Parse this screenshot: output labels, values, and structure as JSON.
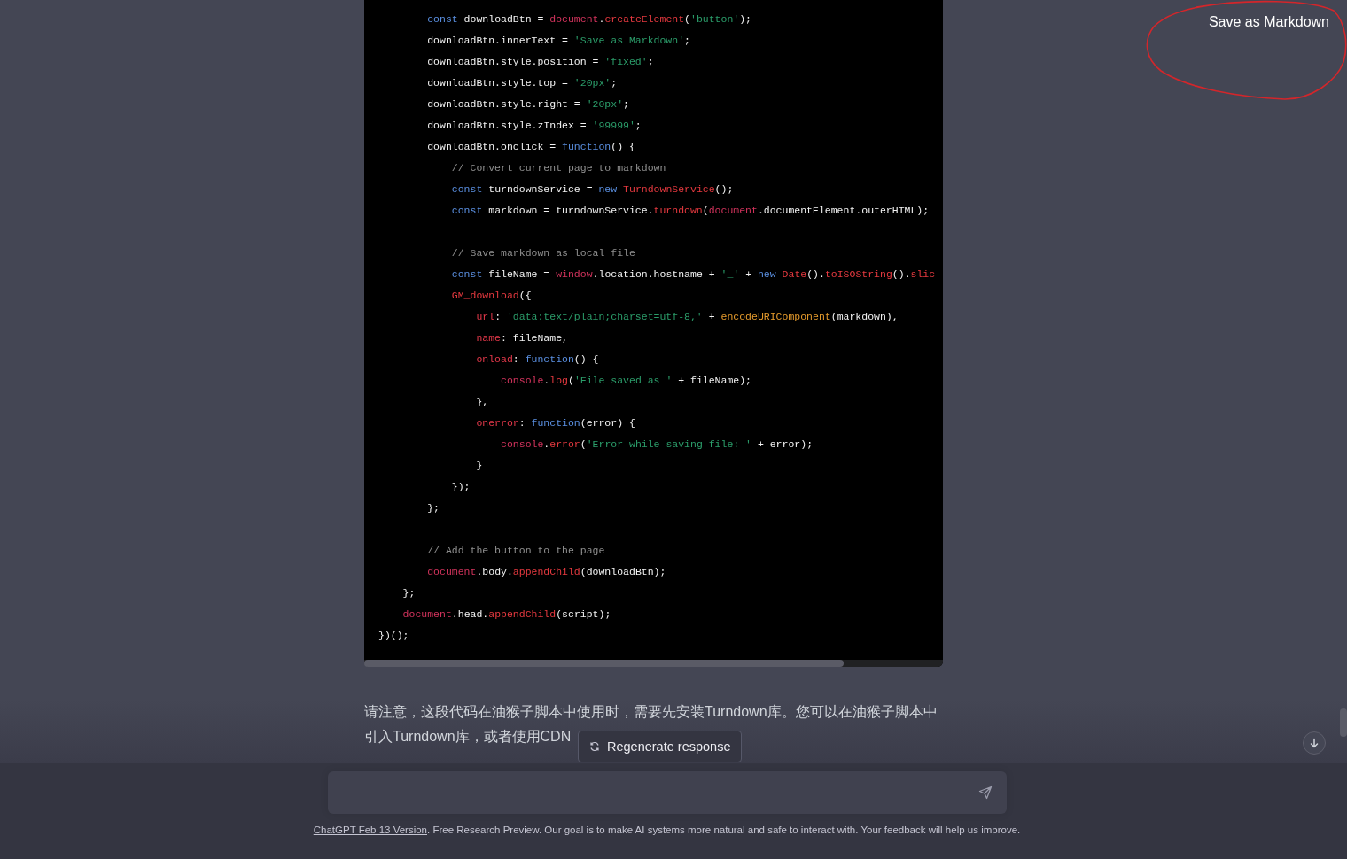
{
  "code_block": {
    "lines": [
      {
        "kind": "code",
        "tokens": [
          {
            "kind": "kw",
            "t": "        const"
          },
          {
            "kind": "plain",
            "t": " downloadBtn = "
          },
          {
            "kind": "obj",
            "t": "document"
          },
          {
            "kind": "plain",
            "t": "."
          },
          {
            "kind": "fn",
            "t": "createElement"
          },
          {
            "kind": "plain",
            "t": "("
          },
          {
            "kind": "str",
            "t": "'button'"
          },
          {
            "kind": "plain",
            "t": ");"
          }
        ]
      },
      {
        "kind": "code",
        "tokens": [
          {
            "kind": "plain",
            "t": "        downloadBtn.innerText = "
          },
          {
            "kind": "str",
            "t": "'Save as Markdown'"
          },
          {
            "kind": "plain",
            "t": ";"
          }
        ]
      },
      {
        "kind": "code",
        "tokens": [
          {
            "kind": "plain",
            "t": "        downloadBtn.style.position = "
          },
          {
            "kind": "str",
            "t": "'fixed'"
          },
          {
            "kind": "plain",
            "t": ";"
          }
        ]
      },
      {
        "kind": "code",
        "tokens": [
          {
            "kind": "plain",
            "t": "        downloadBtn.style.top = "
          },
          {
            "kind": "str",
            "t": "'20px'"
          },
          {
            "kind": "plain",
            "t": ";"
          }
        ]
      },
      {
        "kind": "code",
        "tokens": [
          {
            "kind": "plain",
            "t": "        downloadBtn.style.right = "
          },
          {
            "kind": "str",
            "t": "'20px'"
          },
          {
            "kind": "plain",
            "t": ";"
          }
        ]
      },
      {
        "kind": "code",
        "tokens": [
          {
            "kind": "plain",
            "t": "        downloadBtn.style.zIndex = "
          },
          {
            "kind": "str",
            "t": "'99999'"
          },
          {
            "kind": "plain",
            "t": ";"
          }
        ]
      },
      {
        "kind": "code",
        "tokens": [
          {
            "kind": "plain",
            "t": "        downloadBtn.onclick = "
          },
          {
            "kind": "kw",
            "t": "function"
          },
          {
            "kind": "plain",
            "t": "() {"
          }
        ]
      },
      {
        "kind": "code",
        "tokens": [
          {
            "kind": "cmt",
            "t": "            // Convert current page to markdown"
          }
        ]
      },
      {
        "kind": "code",
        "tokens": [
          {
            "kind": "kw",
            "t": "            const"
          },
          {
            "kind": "plain",
            "t": " turndownService = "
          },
          {
            "kind": "kw",
            "t": "new"
          },
          {
            "kind": "fn",
            "t": " TurndownService"
          },
          {
            "kind": "plain",
            "t": "();"
          }
        ]
      },
      {
        "kind": "code",
        "tokens": [
          {
            "kind": "kw",
            "t": "            const"
          },
          {
            "kind": "plain",
            "t": " markdown = turndownService."
          },
          {
            "kind": "fn",
            "t": "turndown"
          },
          {
            "kind": "plain",
            "t": "("
          },
          {
            "kind": "obj",
            "t": "document"
          },
          {
            "kind": "plain",
            "t": ".documentElement.outerHTML);"
          }
        ]
      },
      {
        "kind": "blank"
      },
      {
        "kind": "code",
        "tokens": [
          {
            "kind": "cmt",
            "t": "            // Save markdown as local file"
          }
        ]
      },
      {
        "kind": "code",
        "tokens": [
          {
            "kind": "kw",
            "t": "            const"
          },
          {
            "kind": "plain",
            "t": " fileName = "
          },
          {
            "kind": "obj",
            "t": "window"
          },
          {
            "kind": "plain",
            "t": ".location.hostname + "
          },
          {
            "kind": "str",
            "t": "'_'"
          },
          {
            "kind": "plain",
            "t": " + "
          },
          {
            "kind": "kw",
            "t": "new"
          },
          {
            "kind": "fn",
            "t": " Date"
          },
          {
            "kind": "plain",
            "t": "()."
          },
          {
            "kind": "fn",
            "t": "toISOString"
          },
          {
            "kind": "plain",
            "t": "()."
          },
          {
            "kind": "fn",
            "t": "slic"
          }
        ]
      },
      {
        "kind": "code",
        "tokens": [
          {
            "kind": "fn",
            "t": "            GM_download"
          },
          {
            "kind": "plain",
            "t": "({"
          }
        ]
      },
      {
        "kind": "code",
        "tokens": [
          {
            "kind": "prop",
            "t": "                url"
          },
          {
            "kind": "plain",
            "t": ": "
          },
          {
            "kind": "str",
            "t": "'data:text/plain;charset=utf-8,'"
          },
          {
            "kind": "plain",
            "t": " + "
          },
          {
            "kind": "call",
            "t": "encodeURIComponent"
          },
          {
            "kind": "plain",
            "t": "(markdown),"
          }
        ]
      },
      {
        "kind": "code",
        "tokens": [
          {
            "kind": "prop",
            "t": "                name"
          },
          {
            "kind": "plain",
            "t": ": fileName,"
          }
        ]
      },
      {
        "kind": "code",
        "tokens": [
          {
            "kind": "prop",
            "t": "                onload"
          },
          {
            "kind": "plain",
            "t": ": "
          },
          {
            "kind": "kw",
            "t": "function"
          },
          {
            "kind": "plain",
            "t": "() {"
          }
        ]
      },
      {
        "kind": "code",
        "tokens": [
          {
            "kind": "obj",
            "t": "                    console"
          },
          {
            "kind": "plain",
            "t": "."
          },
          {
            "kind": "fn",
            "t": "log"
          },
          {
            "kind": "plain",
            "t": "("
          },
          {
            "kind": "str",
            "t": "'File saved as '"
          },
          {
            "kind": "plain",
            "t": " + fileName);"
          }
        ]
      },
      {
        "kind": "code",
        "tokens": [
          {
            "kind": "plain",
            "t": "                },"
          }
        ]
      },
      {
        "kind": "code",
        "tokens": [
          {
            "kind": "prop",
            "t": "                onerror"
          },
          {
            "kind": "plain",
            "t": ": "
          },
          {
            "kind": "kw",
            "t": "function"
          },
          {
            "kind": "plain",
            "t": "(error) {"
          }
        ]
      },
      {
        "kind": "code",
        "tokens": [
          {
            "kind": "obj",
            "t": "                    console"
          },
          {
            "kind": "plain",
            "t": "."
          },
          {
            "kind": "fn",
            "t": "error"
          },
          {
            "kind": "plain",
            "t": "("
          },
          {
            "kind": "str",
            "t": "'Error while saving file: '"
          },
          {
            "kind": "plain",
            "t": " + error);"
          }
        ]
      },
      {
        "kind": "code",
        "tokens": [
          {
            "kind": "plain",
            "t": "                }"
          }
        ]
      },
      {
        "kind": "code",
        "tokens": [
          {
            "kind": "plain",
            "t": "            });"
          }
        ]
      },
      {
        "kind": "code",
        "tokens": [
          {
            "kind": "plain",
            "t": "        };"
          }
        ]
      },
      {
        "kind": "blank"
      },
      {
        "kind": "code",
        "tokens": [
          {
            "kind": "cmt",
            "t": "        // Add the button to the page"
          }
        ]
      },
      {
        "kind": "code",
        "tokens": [
          {
            "kind": "obj",
            "t": "        document"
          },
          {
            "kind": "plain",
            "t": ".body."
          },
          {
            "kind": "fn",
            "t": "appendChild"
          },
          {
            "kind": "plain",
            "t": "(downloadBtn);"
          }
        ]
      },
      {
        "kind": "code",
        "tokens": [
          {
            "kind": "plain",
            "t": "    };"
          }
        ]
      },
      {
        "kind": "code",
        "tokens": [
          {
            "kind": "obj",
            "t": "    document"
          },
          {
            "kind": "plain",
            "t": ".head."
          },
          {
            "kind": "fn",
            "t": "appendChild"
          },
          {
            "kind": "plain",
            "t": "(script);"
          }
        ]
      },
      {
        "kind": "code",
        "tokens": [
          {
            "kind": "plain",
            "t": "})();"
          }
        ]
      }
    ]
  },
  "message": {
    "lines": [
      "请注意，这段代码在油猴子脚本中使用时，需要先安装Turndown库。您可以在油猴子脚本中",
      "引入Turndown库，或者使用CDN"
    ]
  },
  "regenerate_button": {
    "label": "Regenerate response"
  },
  "save_button": {
    "label": "Save as Markdown"
  },
  "footer": {
    "link": "ChatGPT Feb 13 Version",
    "text": ". Free Research Preview. Our goal is to make AI systems more natural and safe to interact with. Your feedback will help us improve."
  }
}
